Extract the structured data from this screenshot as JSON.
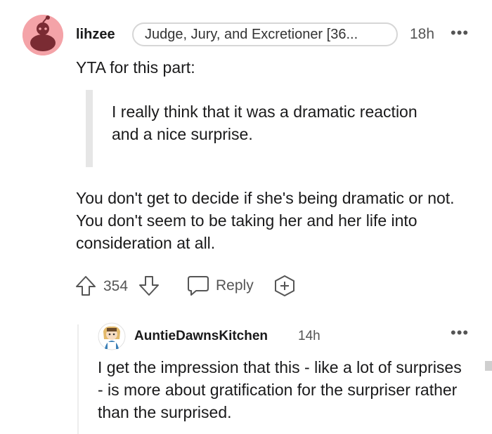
{
  "top_comment": {
    "username": "lihzee",
    "flair": "Judge, Jury, and Excretioner [36...",
    "time": "18h",
    "more": "•••",
    "intro": "YTA for this part:",
    "quote": "I really think that it was a dramatic reaction and a nice surprise.",
    "body": "You don't get to decide if she's being dramatic or not. You don't seem to be taking her and her life into consideration at all.",
    "score": "354",
    "reply_label": "Reply",
    "colors": {
      "avatar_bg": "#f4a3a8",
      "text": "#1a1a1b",
      "meta": "#555555"
    }
  },
  "reply_comment": {
    "username": "AuntieDawnsKitchen",
    "time": "14h",
    "more": "•••",
    "body": "I get the impression that this - like a lot of surprises - is more about gratification for the surpriser rather than the surprised."
  },
  "icons": [
    "snoo-avatar-icon",
    "upvote-icon",
    "downvote-icon",
    "reply-icon",
    "award-icon",
    "user-avatar-icon"
  ]
}
